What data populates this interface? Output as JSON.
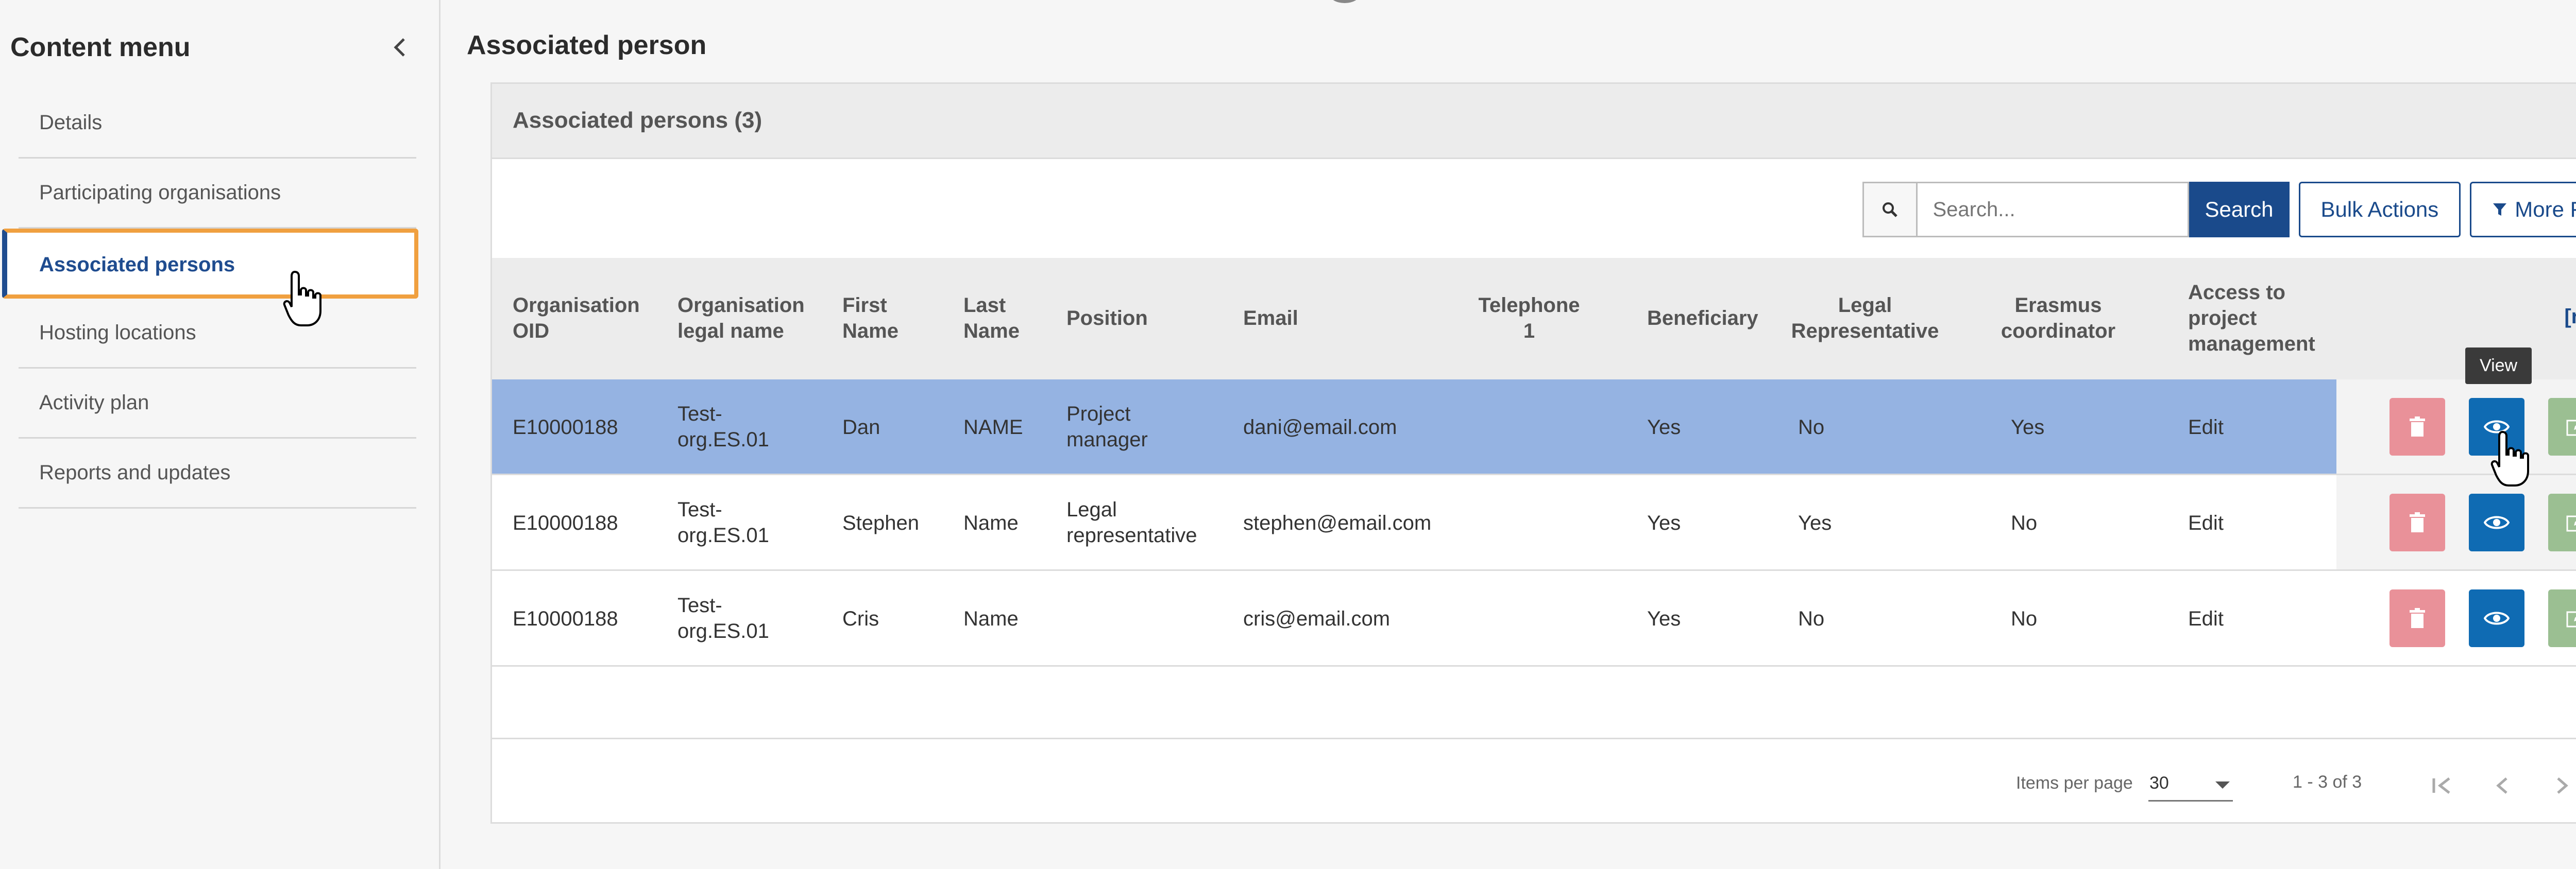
{
  "sidebar": {
    "title": "Content menu",
    "items": [
      {
        "label": "Details",
        "active": false
      },
      {
        "label": "Participating organisations",
        "active": false
      },
      {
        "label": "Associated persons",
        "active": true
      },
      {
        "label": "Hosting locations",
        "active": false
      },
      {
        "label": "Activity plan",
        "active": false
      },
      {
        "label": "Reports and updates",
        "active": false
      }
    ]
  },
  "main": {
    "title": "Associated person",
    "card_title": "Associated persons (3)",
    "search": {
      "placeholder": "Search...",
      "button": "Search"
    },
    "bulk_actions": "Bulk Actions",
    "more_filters": "More Filters",
    "reload": "[reload]",
    "tooltip": "View",
    "columns": {
      "oid": "Organisation OID",
      "legal_name": "Organisation legal name",
      "first": "First Name",
      "last": "Last Name",
      "position": "Position",
      "email": "Email",
      "phone": "Telephone 1",
      "beneficiary": "Beneficiary",
      "legal_rep": "Legal Representative",
      "erasmus": "Erasmus coordinator",
      "access": "Access to project management"
    },
    "rows": [
      {
        "oid": "E10000188",
        "legal_name": "Test-org.ES.01",
        "first": "Dan",
        "last": "NAME",
        "position": "Project manager",
        "email": "dani@email.com",
        "phone": "",
        "beneficiary": "Yes",
        "legal_rep": "No",
        "erasmus": "Yes",
        "access": "Edit",
        "selected": true
      },
      {
        "oid": "E10000188",
        "legal_name": "Test-org.ES.01",
        "first": "Stephen",
        "last": "Name",
        "position": "Legal representative",
        "email": "stephen@email.com",
        "phone": "",
        "beneficiary": "Yes",
        "legal_rep": "Yes",
        "erasmus": "No",
        "access": "Edit",
        "selected": false
      },
      {
        "oid": "E10000188",
        "legal_name": "Test-org.ES.01",
        "first": "Cris",
        "last": "Name",
        "position": "",
        "email": "cris@email.com",
        "phone": "",
        "beneficiary": "Yes",
        "legal_rep": "No",
        "erasmus": "No",
        "access": "Edit",
        "selected": false
      }
    ],
    "footer": {
      "items_per_page_label": "Items per page",
      "items_per_page": "30",
      "range": "1 - 3 of 3"
    }
  },
  "colors": {
    "accent": "#1a4a8b",
    "selected_row": "#95b3e2",
    "delete": "#e99199",
    "view": "#0f6bb3",
    "edit": "#9bbf92",
    "active_outline": "#f0a040"
  },
  "icons": [
    "chevron-left-icon",
    "search-icon",
    "filter-icon",
    "trash-icon",
    "eye-icon",
    "edit-icon",
    "first-page-icon",
    "prev-page-icon",
    "next-page-icon",
    "last-page-icon",
    "hand-cursor-icon"
  ]
}
